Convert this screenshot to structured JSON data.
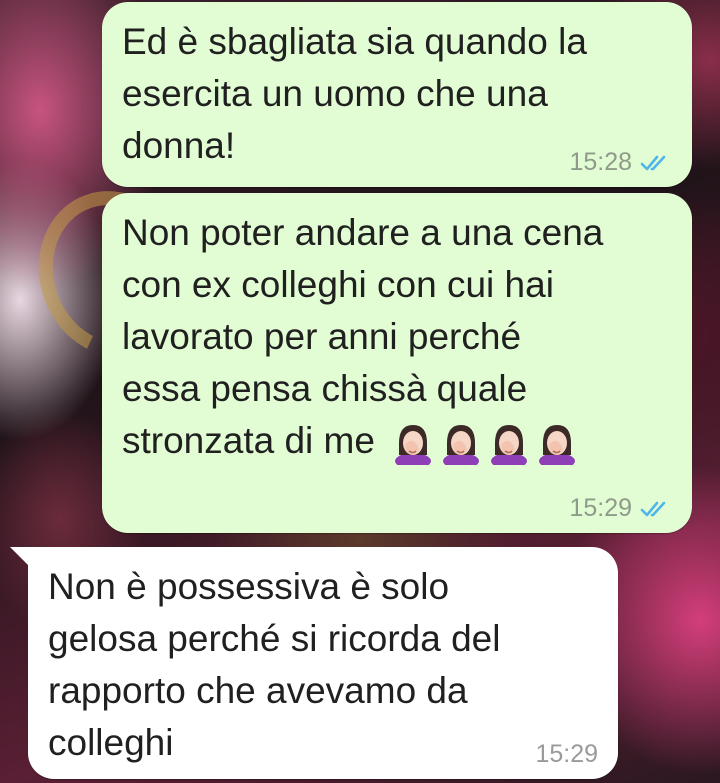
{
  "chat": {
    "messages": [
      {
        "direction": "outgoing",
        "lines": [
          "Ed è sbagliata sia quando la",
          "esercita un uomo che una",
          "donna!"
        ],
        "time": "15:28",
        "status_icon": "double-check-read-icon"
      },
      {
        "direction": "outgoing",
        "lines": [
          "Non poter andare a una cena",
          "con ex colleghi con cui hai",
          "lavorato per anni perché",
          "essa pensa chissà quale",
          "stronzata di me"
        ],
        "emojis": [
          "woman-facepalming-icon",
          "woman-facepalming-icon",
          "woman-facepalming-icon",
          "woman-facepalming-icon"
        ],
        "time": "15:29",
        "status_icon": "double-check-read-icon"
      },
      {
        "direction": "incoming",
        "lines": [
          "Non è possessiva è solo",
          "gelosa perché si ricorda del",
          "rapporto che avevamo da",
          "colleghi"
        ],
        "time": "15:29"
      }
    ]
  },
  "colors": {
    "outgoing_bubble": "#e2fdd4",
    "incoming_bubble": "#ffffff",
    "read_ticks": "#4fb6ec",
    "text": "#202020"
  }
}
